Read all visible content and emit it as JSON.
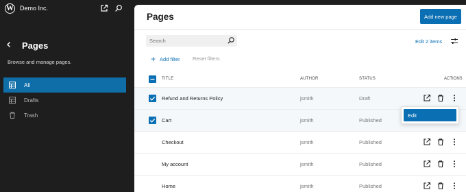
{
  "topbar": {
    "site_name": "Demo Inc.",
    "logo_icon": "wordpress-logo-icon",
    "view_site_icon": "external-link-icon",
    "search_icon": "search-icon"
  },
  "sidebar": {
    "title": "Pages",
    "description": "Browse and manage pages.",
    "items": [
      {
        "label": "All",
        "icon": "pages-icon",
        "active": true
      },
      {
        "label": "Drafts",
        "icon": "drafts-icon",
        "active": false
      },
      {
        "label": "Trash",
        "icon": "trash-icon",
        "active": false
      }
    ]
  },
  "main": {
    "title": "Pages",
    "add_new_label": "Add new page",
    "search_placeholder": "Search",
    "edit_items_label": "Edit 2 items",
    "add_filter_label": "Add filter",
    "reset_filters_label": "Reset filters",
    "columns": {
      "title": "TITLE",
      "author": "AUTHOR",
      "status": "STATUS",
      "actions": "ACTIONS"
    },
    "rows": [
      {
        "title": "Refund and Returns Policy",
        "author": "jsmith",
        "status": "Draft",
        "selected": true
      },
      {
        "title": "Cart",
        "author": "jsmith",
        "status": "Published",
        "selected": true
      },
      {
        "title": "Checkout",
        "author": "jsmith",
        "status": "Published",
        "selected": false
      },
      {
        "title": "My account",
        "author": "jsmith",
        "status": "Published",
        "selected": false
      },
      {
        "title": "Home",
        "author": "jsmith",
        "status": "Published",
        "selected": false
      }
    ],
    "dropdown": {
      "items": [
        "Edit"
      ]
    }
  },
  "colors": {
    "accent": "#0b6fb3",
    "sidebar_bg": "#1e1e1e",
    "sidebar_active": "#0f6ea8"
  }
}
